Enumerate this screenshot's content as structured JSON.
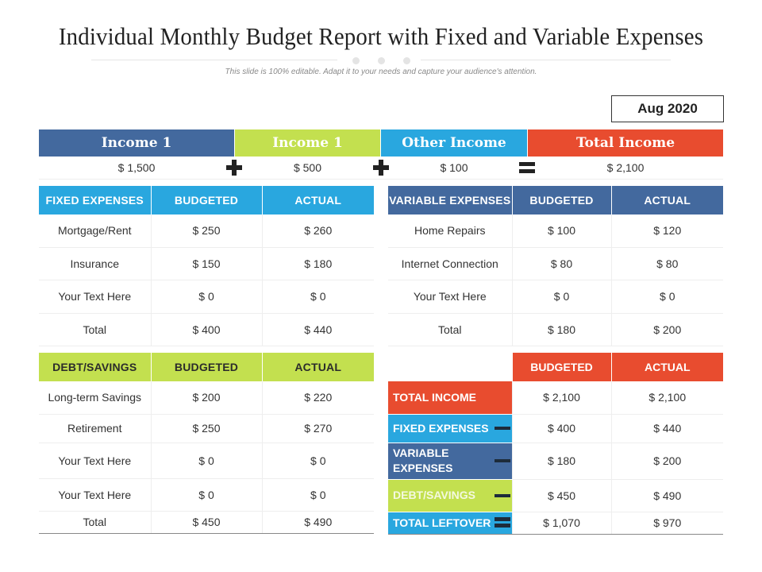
{
  "title": "Individual Monthly Budget Report with Fixed and Variable Expenses",
  "subtitle": "This slide is 100% editable. Adapt it to your needs and capture your audience's attention.",
  "date": "Aug 2020",
  "colors": {
    "blue_dark": "#43699e",
    "green": "#c3e04f",
    "blue_light": "#29a7df",
    "red": "#e84c2f"
  },
  "income": {
    "headers": [
      "Income 1",
      "Income 1",
      "Other Income",
      "Total Income"
    ],
    "values": [
      "$ 1,500",
      "$ 500",
      "$ 100",
      "$ 2,100"
    ],
    "operators": [
      "plus-icon",
      "plus-icon",
      "equals-icon"
    ]
  },
  "fixed_expenses": {
    "headers": [
      "FIXED EXPENSES",
      "BUDGETED",
      "ACTUAL"
    ],
    "rows": [
      [
        "Mortgage/Rent",
        "$ 250",
        "$ 260"
      ],
      [
        "Insurance",
        "$ 150",
        "$ 180"
      ],
      [
        "Your Text Here",
        "$ 0",
        "$ 0"
      ],
      [
        "Total",
        "$ 400",
        "$ 440"
      ]
    ]
  },
  "variable_expenses": {
    "headers": [
      "VARIABLE EXPENSES",
      "BUDGETED",
      "ACTUAL"
    ],
    "rows": [
      [
        "Home Repairs",
        "$ 100",
        "$ 120"
      ],
      [
        "Internet Connection",
        "$ 80",
        "$ 80"
      ],
      [
        "Your Text Here",
        "$ 0",
        "$ 0"
      ],
      [
        "Total",
        "$ 180",
        "$ 200"
      ]
    ]
  },
  "debt_savings": {
    "headers": [
      "DEBT/SAVINGS",
      "BUDGETED",
      "ACTUAL"
    ],
    "rows": [
      [
        "Long-term Savings",
        "$ 200",
        "$ 220"
      ],
      [
        "Retirement",
        "$ 250",
        "$ 270"
      ],
      [
        "Your Text Here",
        "$ 0",
        "$ 0"
      ],
      [
        "Your Text Here",
        "$ 0",
        "$ 0"
      ],
      [
        "Total",
        "$ 450",
        "$ 490"
      ]
    ]
  },
  "summary": {
    "headers": [
      "",
      "BUDGETED",
      "ACTUAL"
    ],
    "rows": [
      {
        "label": "TOTAL INCOME",
        "budgeted": "$ 2,100",
        "actual": "$ 2,100",
        "operator": ""
      },
      {
        "label": "FIXED EXPENSES",
        "budgeted": "$ 400",
        "actual": "$ 440",
        "operator": "minus-icon"
      },
      {
        "label": "VARIABLE EXPENSES",
        "budgeted": "$ 180",
        "actual": "$ 200",
        "operator": "minus-icon"
      },
      {
        "label": "DEBT/SAVINGS",
        "budgeted": "$ 450",
        "actual": "$ 490",
        "operator": "minus-icon"
      },
      {
        "label": "TOTAL LEFTOVER",
        "budgeted": "$ 1,070",
        "actual": "$ 970",
        "operator": "equals-icon"
      }
    ]
  }
}
